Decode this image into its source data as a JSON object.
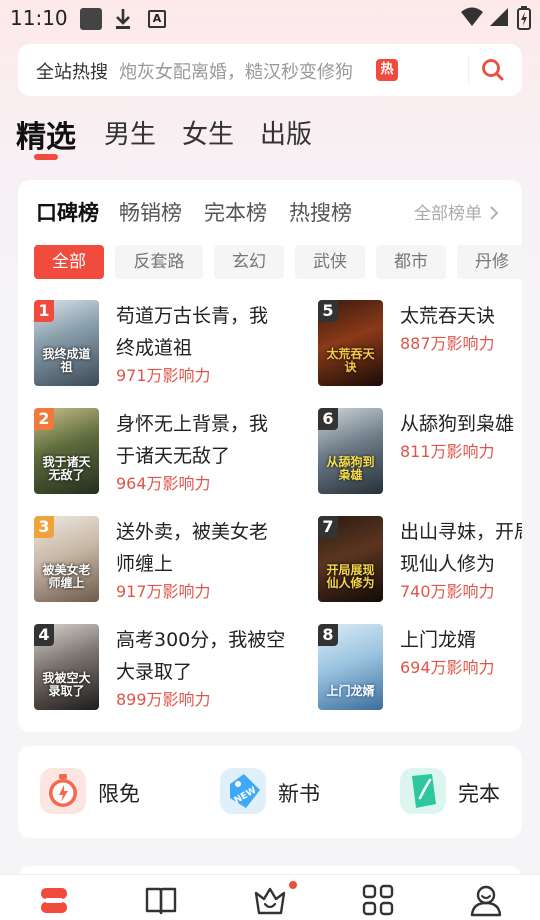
{
  "status_bar": {
    "time": "11:10",
    "icons": [
      "screen-record-icon",
      "download-icon",
      "font-a-icon",
      "wifi-icon",
      "signal-icon",
      "battery-charging-icon"
    ]
  },
  "search": {
    "label": "全站热搜",
    "hint": "炮灰女配离婚，糙汉秒变修狗",
    "badge": "热",
    "icon": "search-icon"
  },
  "top_tabs": [
    {
      "label": "精选",
      "active": true
    },
    {
      "label": "男生",
      "active": false
    },
    {
      "label": "女生",
      "active": false
    },
    {
      "label": "出版",
      "active": false
    }
  ],
  "ranking": {
    "tabs": [
      {
        "label": "口碑榜",
        "active": true
      },
      {
        "label": "畅销榜",
        "active": false
      },
      {
        "label": "完本榜",
        "active": false
      },
      {
        "label": "热搜榜",
        "active": false
      }
    ],
    "all_lists": "全部榜单",
    "chips": [
      {
        "label": "全部",
        "active": true
      },
      {
        "label": "反套路",
        "active": false
      },
      {
        "label": "玄幻",
        "active": false
      },
      {
        "label": "武侠",
        "active": false
      },
      {
        "label": "都市",
        "active": false
      },
      {
        "label": "丹修",
        "active": false
      }
    ],
    "books": [
      {
        "rank": "1",
        "title": "苟道万古长青，我终成道祖",
        "influence": "971万影响力",
        "cover_text": "我终成道祖"
      },
      {
        "rank": "2",
        "title": "身怀无上背景，我于诸天无敌了",
        "influence": "964万影响力",
        "cover_text": "我于诸天无敌了"
      },
      {
        "rank": "3",
        "title": "送外卖，被美女老师缠上",
        "influence": "917万影响力",
        "cover_text": "被美女老师缠上"
      },
      {
        "rank": "4",
        "title": "高考300分，我被空大录取了",
        "influence": "899万影响力",
        "cover_text": "我被空大录取了"
      },
      {
        "rank": "5",
        "title": "太荒吞天诀",
        "influence": "887万影响力",
        "cover_text": "太荒吞天诀"
      },
      {
        "rank": "6",
        "title": "从舔狗到枭雄",
        "influence": "811万影响力",
        "cover_text": "从舔狗到枭雄"
      },
      {
        "rank": "7",
        "title": "出山寻妹，开局展现仙人修为",
        "influence": "740万影响力",
        "cover_text": "开局展现仙人修为"
      },
      {
        "rank": "8",
        "title": "上门龙婿",
        "influence": "694万影响力",
        "cover_text": "上门龙婿"
      }
    ]
  },
  "shortcuts": [
    {
      "label": "限免",
      "icon": "stopwatch-icon"
    },
    {
      "label": "新书",
      "icon": "new-tag-icon"
    },
    {
      "label": "完本",
      "icon": "book-complete-icon"
    }
  ],
  "bottom_nav": [
    {
      "name": "bookstore",
      "icon": "bookstore-icon",
      "active": true
    },
    {
      "name": "bookshelf",
      "icon": "open-book-icon",
      "active": false
    },
    {
      "name": "welfare",
      "icon": "crown-icon",
      "active": false,
      "has_dot": true
    },
    {
      "name": "category",
      "icon": "grid-icon",
      "active": false
    },
    {
      "name": "profile",
      "icon": "person-icon",
      "active": false
    }
  ],
  "colors": {
    "accent": "#f04b3c",
    "influence": "#e0554a",
    "rank_top3": "#f04b3c",
    "rank_top3_alt": "#f07a3c",
    "rank_other": "#333333"
  }
}
